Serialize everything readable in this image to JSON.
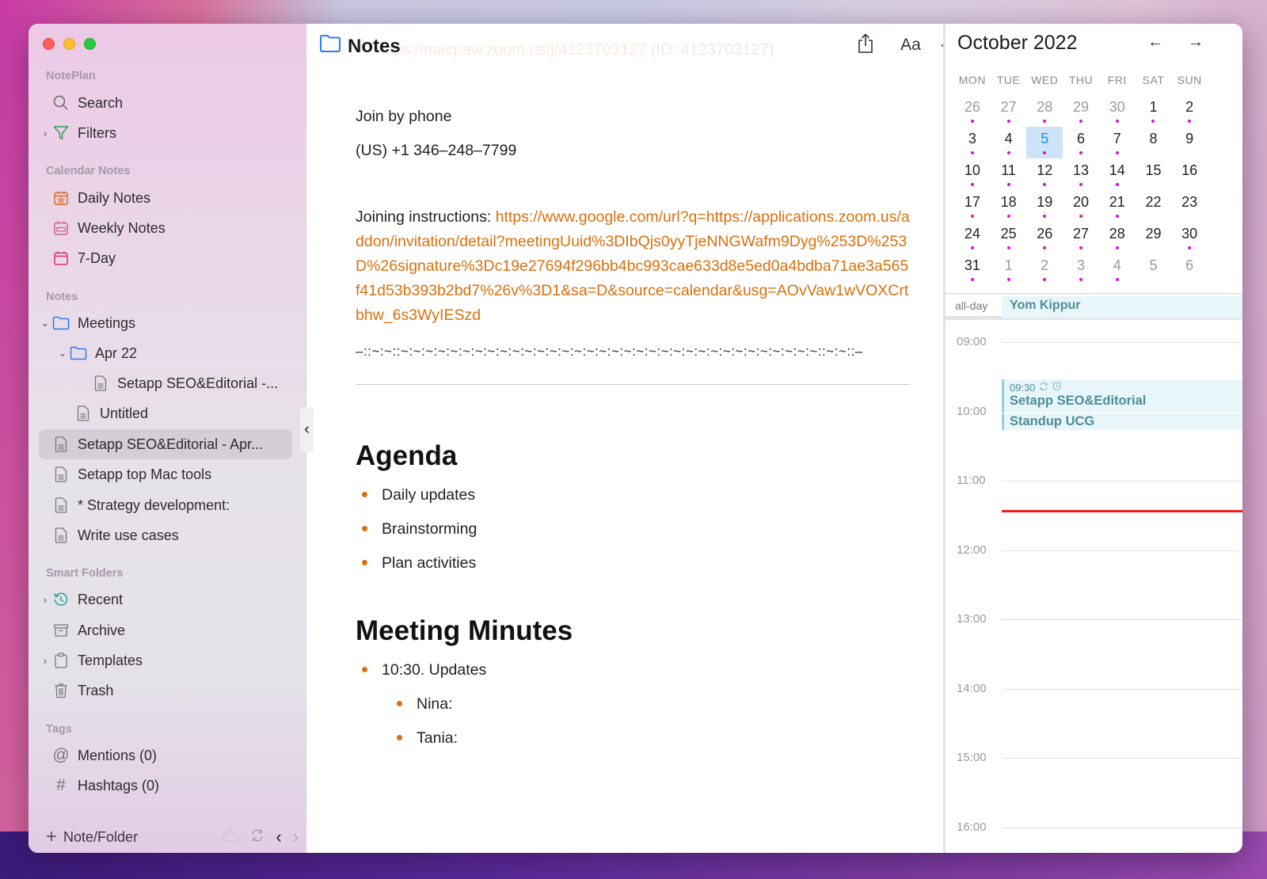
{
  "window": {
    "app_name": "NotePlan"
  },
  "sidebar": {
    "sections": {
      "noteplan": "NotePlan",
      "calendar_notes": "Calendar Notes",
      "notes": "Notes",
      "smart_folders": "Smart Folders",
      "tags": "Tags"
    },
    "top_items": [
      {
        "label": "Search",
        "icon": "search-icon"
      },
      {
        "label": "Filters",
        "icon": "filter-icon",
        "expandable": true
      }
    ],
    "calendar_items": [
      {
        "label": "Daily Notes",
        "icon": "daily-calendar-icon",
        "color": "#e06a1e"
      },
      {
        "label": "Weekly Notes",
        "icon": "weekly-calendar-icon",
        "color": "#d0628f"
      },
      {
        "label": "7-Day",
        "icon": "seven-day-calendar-icon",
        "color": "#d6336c"
      }
    ],
    "notes_tree": [
      {
        "label": "Meetings",
        "type": "folder",
        "expanded": true,
        "level": 0
      },
      {
        "label": "Apr 22",
        "type": "folder",
        "expanded": true,
        "level": 1
      },
      {
        "label": "Setapp SEO&Editorial -...",
        "type": "note",
        "level": 2
      },
      {
        "label": "Untitled",
        "type": "note",
        "level": 1
      },
      {
        "label": "Setapp SEO&Editorial - Apr...",
        "type": "note",
        "level": 0,
        "selected": true
      },
      {
        "label": "Setapp top Mac tools",
        "type": "note",
        "level": 0
      },
      {
        "label": "* Strategy development:",
        "type": "note",
        "level": 0
      },
      {
        "label": "Write use cases",
        "type": "note",
        "level": 0
      }
    ],
    "smart_items": [
      {
        "label": "Recent",
        "icon": "recent-icon",
        "expandable": true
      },
      {
        "label": "Archive",
        "icon": "archive-icon"
      },
      {
        "label": "Templates",
        "icon": "clipboard-icon",
        "expandable": true
      },
      {
        "label": "Trash",
        "icon": "trash-icon"
      }
    ],
    "tag_items": [
      {
        "label": "Mentions (0)",
        "icon": "at-icon"
      },
      {
        "label": "Hashtags (0)",
        "icon": "hash-icon"
      }
    ],
    "footer": {
      "new_label": "Note/Folder"
    }
  },
  "editor": {
    "folder_title": "Notes",
    "ghost_url": "https://macpaw.zoom.us/j/4123703127",
    "ghost_id": "(ID: 4123703127)",
    "font_button": "Aa",
    "more_button": "···",
    "join_by_phone": "Join by phone",
    "phone": "(US) +1 346–248–7799",
    "joining_label": "Joining instructions: ",
    "joining_url": "https://www.google.com/url?q=https://applications.zoom.us/addon/invitation/detail?meetingUuid%3DIbQjs0yyTjeNNGWafm9Dyg%253D%253D%26signature%3Dc19e27694f296bb4bc993cae633d8e5ed0a4bdba71ae3a565f41d53b393b2bd7%26v%3D1&sa=D&source=calendar&usg=AOvVaw1wVOXCrtbhw_6s3WyIESzd",
    "wavy_line": "–::~:~::~:~:~:~:~:~:~:~:~:~:~:~:~:~:~:~:~:~:~:~:~:~:~:~:~:~:~:~:~:~:~:~:~:~::~:~::–",
    "agenda_heading": "Agenda",
    "agenda_items": [
      "Daily updates",
      "Brainstorming",
      "Plan activities"
    ],
    "minutes_heading": "Meeting Minutes",
    "minutes_items": [
      {
        "text": "10:30. Updates",
        "level": 1
      },
      {
        "text": "Nina:",
        "level": 2
      },
      {
        "text": "Tania:",
        "level": 2
      }
    ]
  },
  "calendar": {
    "month_title": "October 2022",
    "weekdays": [
      "MON",
      "TUE",
      "WED",
      "THU",
      "FRI",
      "SAT",
      "SUN"
    ],
    "weeks": [
      [
        {
          "d": "26",
          "m": true,
          "dot": true
        },
        {
          "d": "27",
          "m": true,
          "dot": true
        },
        {
          "d": "28",
          "m": true,
          "dot": true
        },
        {
          "d": "29",
          "m": true,
          "dot": true
        },
        {
          "d": "30",
          "m": true,
          "dot": true
        },
        {
          "d": "1",
          "dot": true
        },
        {
          "d": "2",
          "dot": true
        }
      ],
      [
        {
          "d": "3",
          "dot": true
        },
        {
          "d": "4",
          "dot": true
        },
        {
          "d": "5",
          "dot": true,
          "today": true,
          "sel": true
        },
        {
          "d": "6",
          "dot": true
        },
        {
          "d": "7",
          "dot": true
        },
        {
          "d": "8"
        },
        {
          "d": "9"
        }
      ],
      [
        {
          "d": "10",
          "dot": true
        },
        {
          "d": "11",
          "dot": true
        },
        {
          "d": "12",
          "dot": true
        },
        {
          "d": "13",
          "dot": true
        },
        {
          "d": "14",
          "dot": true
        },
        {
          "d": "15"
        },
        {
          "d": "16"
        }
      ],
      [
        {
          "d": "17",
          "dot": true
        },
        {
          "d": "18",
          "dot": true
        },
        {
          "d": "19",
          "dot": true
        },
        {
          "d": "20",
          "dot": true
        },
        {
          "d": "21",
          "dot": true
        },
        {
          "d": "22"
        },
        {
          "d": "23"
        }
      ],
      [
        {
          "d": "24",
          "dot": true
        },
        {
          "d": "25",
          "dot": true
        },
        {
          "d": "26",
          "dot": true
        },
        {
          "d": "27",
          "dot": true
        },
        {
          "d": "28",
          "dot": true
        },
        {
          "d": "29"
        },
        {
          "d": "30",
          "dot": true
        }
      ],
      [
        {
          "d": "31",
          "dot": true
        },
        {
          "d": "1",
          "m": true,
          "dot": true
        },
        {
          "d": "2",
          "m": true,
          "dot": true
        },
        {
          "d": "3",
          "m": true,
          "dot": true
        },
        {
          "d": "4",
          "m": true,
          "dot": true
        },
        {
          "d": "5",
          "m": true
        },
        {
          "d": "6",
          "m": true
        }
      ]
    ],
    "allday_label": "all-day",
    "allday_event": "Yom Kippur",
    "hours": [
      "09:00",
      "10:00",
      "11:00",
      "12:00",
      "13:00",
      "14:00",
      "15:00",
      "16:00"
    ],
    "events": [
      {
        "time": "09:30",
        "title": "Setapp SEO&Editorial",
        "recurring": true,
        "alarm": true
      },
      {
        "title": "Standup UCG"
      }
    ],
    "accent_dot_color": "#d414d4",
    "now_line_color": "#f01d1d"
  }
}
